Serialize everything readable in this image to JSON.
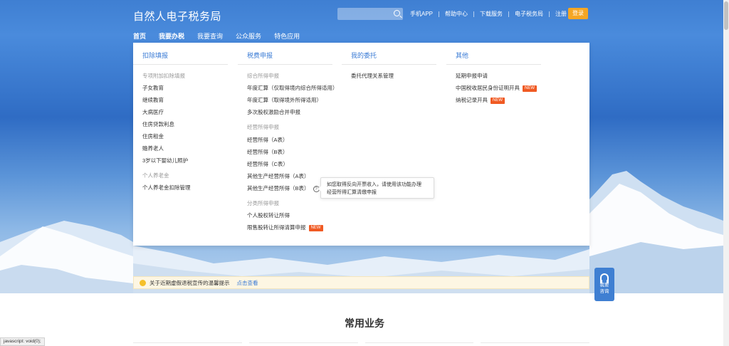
{
  "header": {
    "logo": "自然人电子税务局",
    "search_placeholder": "",
    "links": [
      "手机APP",
      "帮助中心",
      "下载服务",
      "电子税务局",
      "注册"
    ],
    "login": "登录"
  },
  "nav": [
    {
      "label": "首页",
      "active": false
    },
    {
      "label": "我要办税",
      "active": true
    },
    {
      "label": "我要查询",
      "active": false
    },
    {
      "label": "公众服务",
      "active": false
    },
    {
      "label": "特色应用",
      "active": false
    }
  ],
  "menu": {
    "col1": {
      "title": "扣除填报",
      "items": [
        "专项附加扣除填报",
        "子女教育",
        "继续教育",
        "大病医疗",
        "住房贷款利息",
        "住房租金",
        "赡养老人",
        "3岁以下婴幼儿照护",
        "个人养老金",
        "个人养老金扣除管理"
      ]
    },
    "col2": {
      "title": "税费申报",
      "items": [
        "综合所得申报",
        "年度汇算（仅取得境内综合所得适用）",
        "年度汇算（取得境外所得适用）",
        "多次股权激励合并申报",
        "经营所得申报",
        "经营所得（A表）",
        "经营所得（B表）",
        "经营所得（C表）",
        "其他生产经营所得（A表）",
        "其他生产经营所得（B表）",
        "分类所得申报",
        "个人股权转让所得",
        "限售股转让所得清算申报"
      ],
      "badge": "NEW"
    },
    "col3": {
      "title": "我的委托",
      "items": [
        "委托代理关系管理"
      ]
    },
    "col4": {
      "title": "其他",
      "items": [
        "延期申报申请",
        "中国税收居民身份证明开具",
        "纳税记录开具"
      ],
      "badge": "NEW"
    }
  },
  "tooltip": {
    "line1": "如您取得反向开票收入，请使用该功能办理",
    "line2": "经营所得汇算清缴申报"
  },
  "notice": {
    "text": "关于近期虚假退税宣传的温馨提示",
    "link": "点击查看"
  },
  "float_button": {
    "line1": "我要",
    "line2": "咨询"
  },
  "section_title": "常用业务",
  "status_bar": "javascript: void(0);"
}
